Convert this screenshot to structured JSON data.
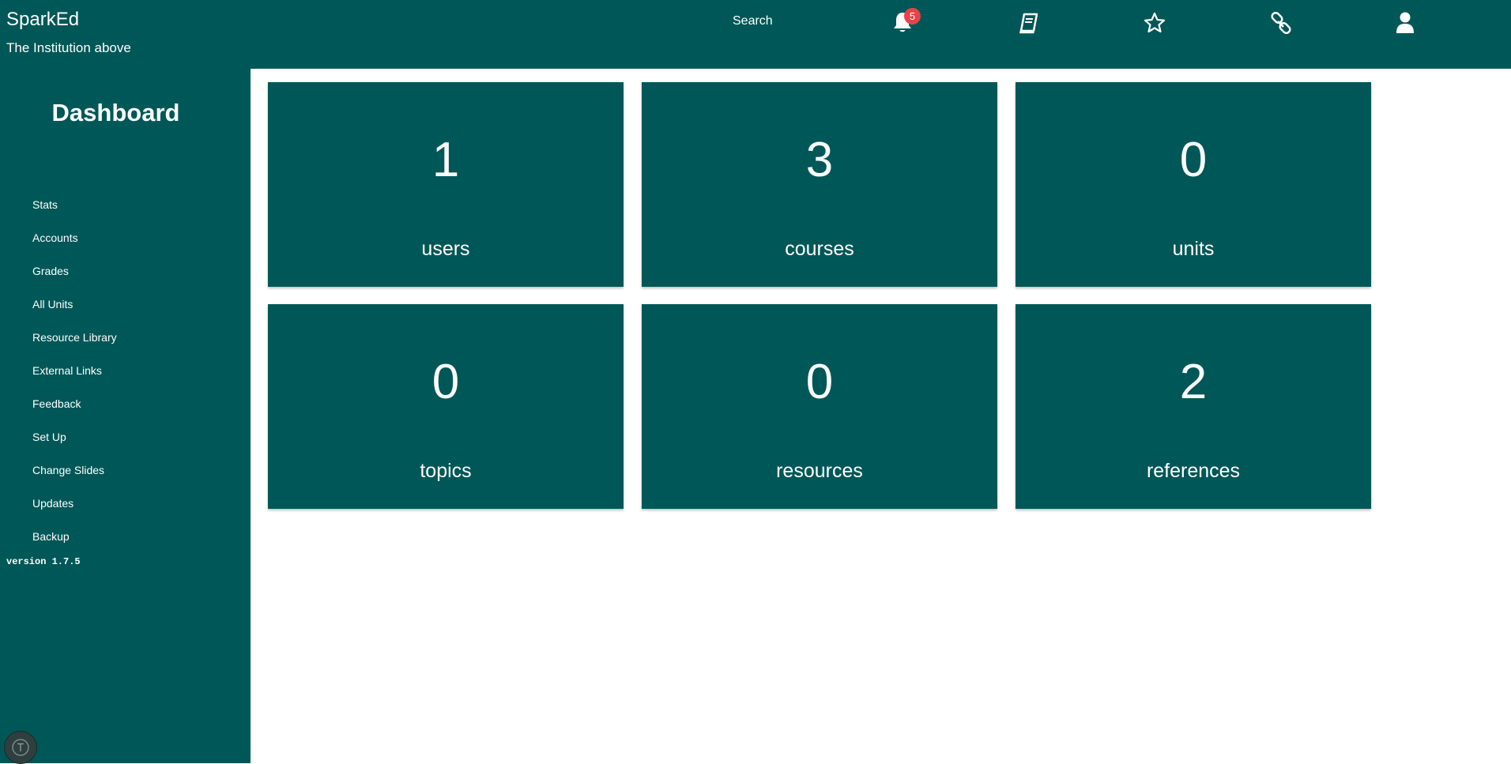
{
  "header": {
    "brand": "SparkEd",
    "institution": "The Institution above",
    "search_label": "Search",
    "notification_count": "5",
    "icons": [
      "bell-icon",
      "book-icon",
      "star-icon",
      "link-icon",
      "user-icon"
    ]
  },
  "sidebar": {
    "title": "Dashboard",
    "items": [
      {
        "label": "Stats"
      },
      {
        "label": "Accounts"
      },
      {
        "label": "Grades"
      },
      {
        "label": "All Units"
      },
      {
        "label": "Resource Library"
      },
      {
        "label": "External Links"
      },
      {
        "label": "Feedback"
      },
      {
        "label": "Set Up"
      },
      {
        "label": "Change Slides"
      },
      {
        "label": "Updates"
      },
      {
        "label": "Backup"
      }
    ],
    "version": "version 1.7.5"
  },
  "tiles": [
    {
      "count": "1",
      "label": "users"
    },
    {
      "count": "3",
      "label": "courses"
    },
    {
      "count": "0",
      "label": "units"
    },
    {
      "count": "0",
      "label": "topics"
    },
    {
      "count": "0",
      "label": "resources"
    },
    {
      "count": "2",
      "label": "references"
    }
  ],
  "colors": {
    "primary": "#005757",
    "badge": "#e8434a",
    "background": "#ffffff"
  }
}
